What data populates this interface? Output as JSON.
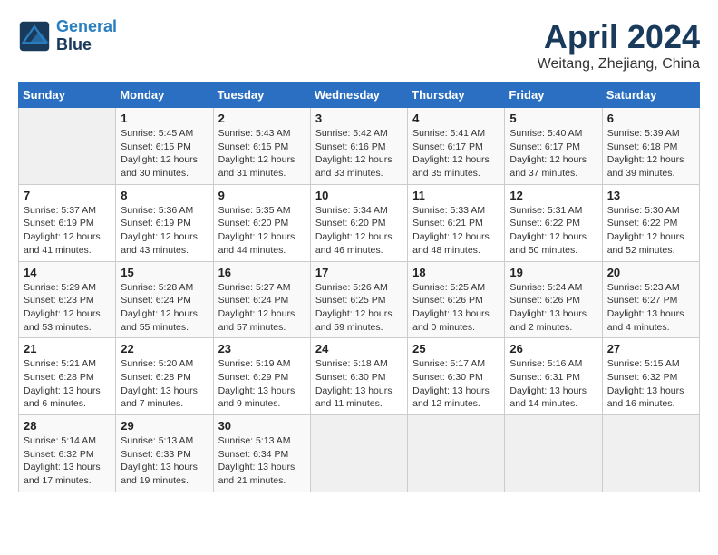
{
  "header": {
    "logo_line1": "General",
    "logo_line2": "Blue",
    "title": "April 2024",
    "subtitle": "Weitang, Zhejiang, China"
  },
  "weekdays": [
    "Sunday",
    "Monday",
    "Tuesday",
    "Wednesday",
    "Thursday",
    "Friday",
    "Saturday"
  ],
  "weeks": [
    [
      {
        "day": "",
        "info": ""
      },
      {
        "day": "1",
        "info": "Sunrise: 5:45 AM\nSunset: 6:15 PM\nDaylight: 12 hours\nand 30 minutes."
      },
      {
        "day": "2",
        "info": "Sunrise: 5:43 AM\nSunset: 6:15 PM\nDaylight: 12 hours\nand 31 minutes."
      },
      {
        "day": "3",
        "info": "Sunrise: 5:42 AM\nSunset: 6:16 PM\nDaylight: 12 hours\nand 33 minutes."
      },
      {
        "day": "4",
        "info": "Sunrise: 5:41 AM\nSunset: 6:17 PM\nDaylight: 12 hours\nand 35 minutes."
      },
      {
        "day": "5",
        "info": "Sunrise: 5:40 AM\nSunset: 6:17 PM\nDaylight: 12 hours\nand 37 minutes."
      },
      {
        "day": "6",
        "info": "Sunrise: 5:39 AM\nSunset: 6:18 PM\nDaylight: 12 hours\nand 39 minutes."
      }
    ],
    [
      {
        "day": "7",
        "info": "Sunrise: 5:37 AM\nSunset: 6:19 PM\nDaylight: 12 hours\nand 41 minutes."
      },
      {
        "day": "8",
        "info": "Sunrise: 5:36 AM\nSunset: 6:19 PM\nDaylight: 12 hours\nand 43 minutes."
      },
      {
        "day": "9",
        "info": "Sunrise: 5:35 AM\nSunset: 6:20 PM\nDaylight: 12 hours\nand 44 minutes."
      },
      {
        "day": "10",
        "info": "Sunrise: 5:34 AM\nSunset: 6:20 PM\nDaylight: 12 hours\nand 46 minutes."
      },
      {
        "day": "11",
        "info": "Sunrise: 5:33 AM\nSunset: 6:21 PM\nDaylight: 12 hours\nand 48 minutes."
      },
      {
        "day": "12",
        "info": "Sunrise: 5:31 AM\nSunset: 6:22 PM\nDaylight: 12 hours\nand 50 minutes."
      },
      {
        "day": "13",
        "info": "Sunrise: 5:30 AM\nSunset: 6:22 PM\nDaylight: 12 hours\nand 52 minutes."
      }
    ],
    [
      {
        "day": "14",
        "info": "Sunrise: 5:29 AM\nSunset: 6:23 PM\nDaylight: 12 hours\nand 53 minutes."
      },
      {
        "day": "15",
        "info": "Sunrise: 5:28 AM\nSunset: 6:24 PM\nDaylight: 12 hours\nand 55 minutes."
      },
      {
        "day": "16",
        "info": "Sunrise: 5:27 AM\nSunset: 6:24 PM\nDaylight: 12 hours\nand 57 minutes."
      },
      {
        "day": "17",
        "info": "Sunrise: 5:26 AM\nSunset: 6:25 PM\nDaylight: 12 hours\nand 59 minutes."
      },
      {
        "day": "18",
        "info": "Sunrise: 5:25 AM\nSunset: 6:26 PM\nDaylight: 13 hours\nand 0 minutes."
      },
      {
        "day": "19",
        "info": "Sunrise: 5:24 AM\nSunset: 6:26 PM\nDaylight: 13 hours\nand 2 minutes."
      },
      {
        "day": "20",
        "info": "Sunrise: 5:23 AM\nSunset: 6:27 PM\nDaylight: 13 hours\nand 4 minutes."
      }
    ],
    [
      {
        "day": "21",
        "info": "Sunrise: 5:21 AM\nSunset: 6:28 PM\nDaylight: 13 hours\nand 6 minutes."
      },
      {
        "day": "22",
        "info": "Sunrise: 5:20 AM\nSunset: 6:28 PM\nDaylight: 13 hours\nand 7 minutes."
      },
      {
        "day": "23",
        "info": "Sunrise: 5:19 AM\nSunset: 6:29 PM\nDaylight: 13 hours\nand 9 minutes."
      },
      {
        "day": "24",
        "info": "Sunrise: 5:18 AM\nSunset: 6:30 PM\nDaylight: 13 hours\nand 11 minutes."
      },
      {
        "day": "25",
        "info": "Sunrise: 5:17 AM\nSunset: 6:30 PM\nDaylight: 13 hours\nand 12 minutes."
      },
      {
        "day": "26",
        "info": "Sunrise: 5:16 AM\nSunset: 6:31 PM\nDaylight: 13 hours\nand 14 minutes."
      },
      {
        "day": "27",
        "info": "Sunrise: 5:15 AM\nSunset: 6:32 PM\nDaylight: 13 hours\nand 16 minutes."
      }
    ],
    [
      {
        "day": "28",
        "info": "Sunrise: 5:14 AM\nSunset: 6:32 PM\nDaylight: 13 hours\nand 17 minutes."
      },
      {
        "day": "29",
        "info": "Sunrise: 5:13 AM\nSunset: 6:33 PM\nDaylight: 13 hours\nand 19 minutes."
      },
      {
        "day": "30",
        "info": "Sunrise: 5:13 AM\nSunset: 6:34 PM\nDaylight: 13 hours\nand 21 minutes."
      },
      {
        "day": "",
        "info": ""
      },
      {
        "day": "",
        "info": ""
      },
      {
        "day": "",
        "info": ""
      },
      {
        "day": "",
        "info": ""
      }
    ]
  ]
}
